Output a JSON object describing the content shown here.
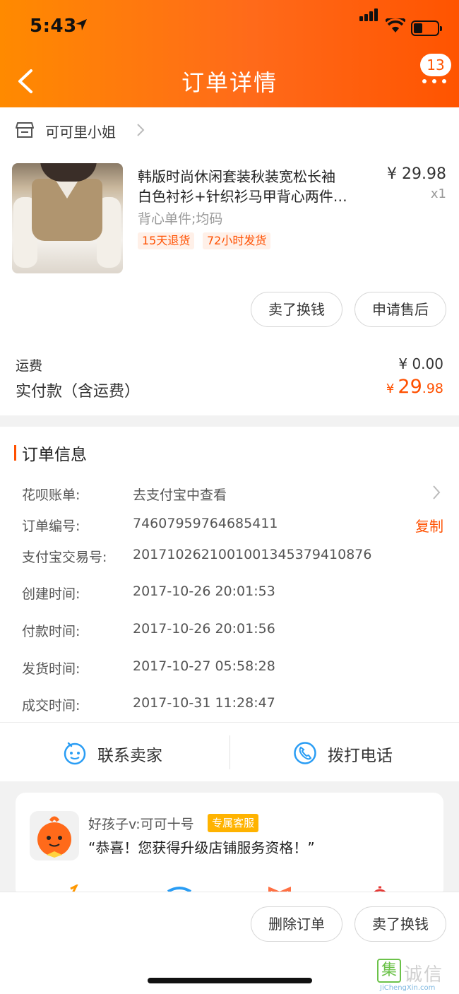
{
  "status_bar": {
    "time": "5:43"
  },
  "header": {
    "title": "订单详情",
    "badge_count": "13",
    "bg_colors": [
      "#ff8a00",
      "#ff5400"
    ]
  },
  "shop": {
    "name": "可可里小姐"
  },
  "product": {
    "title_line1": "韩版时尚休闲套装秋装宽松长袖",
    "title_line2": "白色衬衫+针织衫马甲背心两件…",
    "spec": "背心单件;均码",
    "tags": [
      "15天退货",
      "72小时发货"
    ],
    "price": "¥ 29.98",
    "quantity": "x1"
  },
  "item_actions": {
    "sell": "卖了换钱",
    "after_sale": "申请售后"
  },
  "totals": {
    "shipping_label": "运费",
    "shipping_value": "¥ 0.00",
    "paid_label": "实付款（含运费）",
    "paid_currency": "¥",
    "paid_integer": "29",
    "paid_decimal": ".98"
  },
  "order_info": {
    "title": "订单信息",
    "rows": [
      {
        "label": "花呗账单:",
        "value": "去支付宝中查看"
      },
      {
        "label": "订单编号:",
        "value": "74607959764685411"
      },
      {
        "label": "支付宝交易号:",
        "value": "2017102621001001345379410876"
      },
      {
        "label": "创建时间:",
        "value": "2017-10-26 20:01:53"
      },
      {
        "label": "付款时间:",
        "value": "2017-10-26 20:01:56"
      },
      {
        "label": "发货时间:",
        "value": "2017-10-27 05:58:28"
      },
      {
        "label": "成交时间:",
        "value": "2017-10-31 11:28:47"
      }
    ],
    "copy_label": "复制"
  },
  "contact": {
    "seller": "联系卖家",
    "call": "拨打电话"
  },
  "service": {
    "name": "好孩子v:可可十号",
    "badge": "专属客服",
    "message": "“恭喜！您获得升级店铺服务资格！”"
  },
  "bottom_bar": {
    "delete": "删除订单",
    "sell": "卖了换钱"
  },
  "watermark": {
    "text": "诚信",
    "box_char": "集",
    "url": "JiChengXin.com"
  },
  "accent_color": "#ff5000"
}
